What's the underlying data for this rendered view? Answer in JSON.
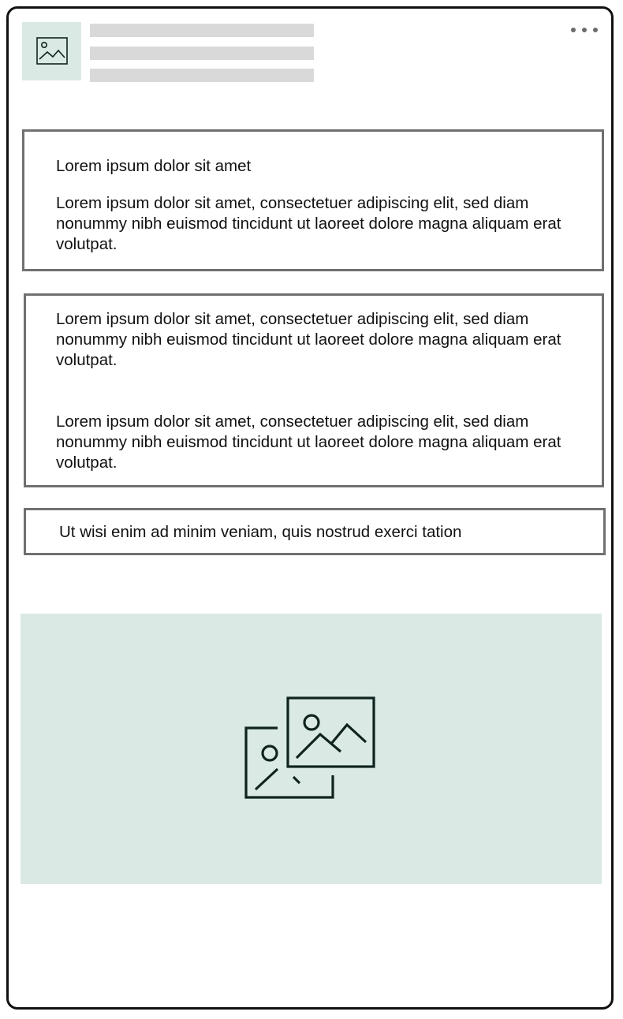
{
  "header": {
    "avatar_icon": "image-placeholder-icon",
    "more_icon": "more-horizontal-icon"
  },
  "cards": {
    "first": {
      "title": "Lorem ipsum dolor sit amet",
      "body": "Lorem ipsum dolor sit amet, consectetuer adipiscing elit, sed diam nonummy nibh euismod tincidunt ut laoreet dolore magna aliquam erat volutpat."
    },
    "second": {
      "paragraph_1": "Lorem ipsum dolor sit amet, consectetuer adipiscing elit, sed diam nonummy nibh euismod tincidunt ut laoreet dolore magna aliquam erat volutpat.",
      "paragraph_2": "Lorem ipsum dolor sit amet, consectetuer adipiscing elit, sed diam nonummy nibh euismod tincidunt ut laoreet dolore magna aliquam erat volutpat."
    },
    "third": {
      "text": "Ut wisi enim ad minim veniam, quis nostrud exerci tation"
    }
  },
  "media": {
    "icon": "images-placeholder-icon"
  },
  "colors": {
    "placeholder_bg": "#dae9e4",
    "skeleton": "#d9d9d9",
    "card_border": "#707070",
    "frame_border": "#111111",
    "icon_stroke": "#10241f"
  }
}
